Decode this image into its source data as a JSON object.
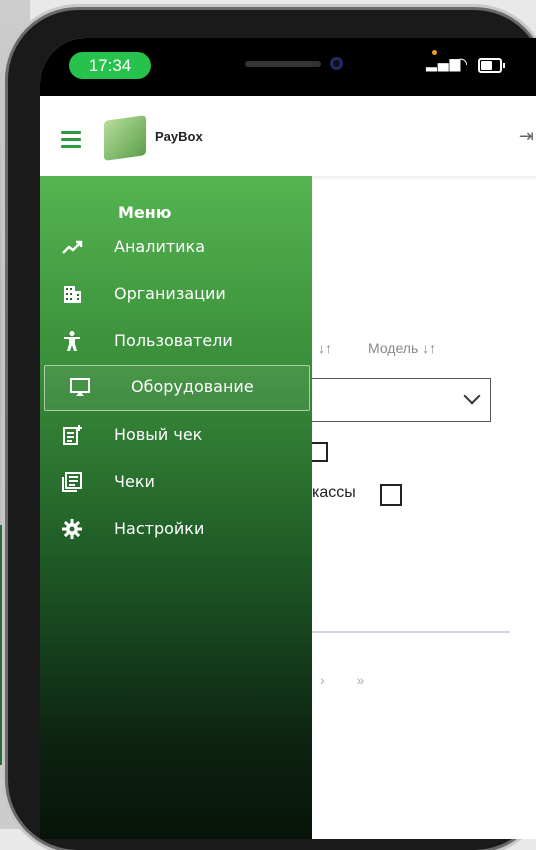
{
  "status_bar": {
    "time": "17:34"
  },
  "header": {
    "brand": "PayBox",
    "logo_text": "PayBox",
    "logout_icon": "logout-icon"
  },
  "drawer": {
    "title": "Меню",
    "items": [
      {
        "label": "Аналитика",
        "icon": "chart-line-icon"
      },
      {
        "label": "Организации",
        "icon": "building-icon"
      },
      {
        "label": "Пользователи",
        "icon": "person-icon"
      },
      {
        "label": "Оборудование",
        "icon": "monitor-icon",
        "active": true
      },
      {
        "label": "Новый чек",
        "icon": "new-receipt-icon"
      },
      {
        "label": "Чеки",
        "icon": "receipts-icon"
      },
      {
        "label": "Настройки",
        "icon": "gear-icon"
      }
    ]
  },
  "content": {
    "sort_left": "↓↑",
    "model_header": "Модель ↓↑",
    "kassy_label": "кассы",
    "pager": "› »"
  },
  "colors": {
    "accent": "#2e9b43",
    "time_pill": "#27c24c"
  }
}
